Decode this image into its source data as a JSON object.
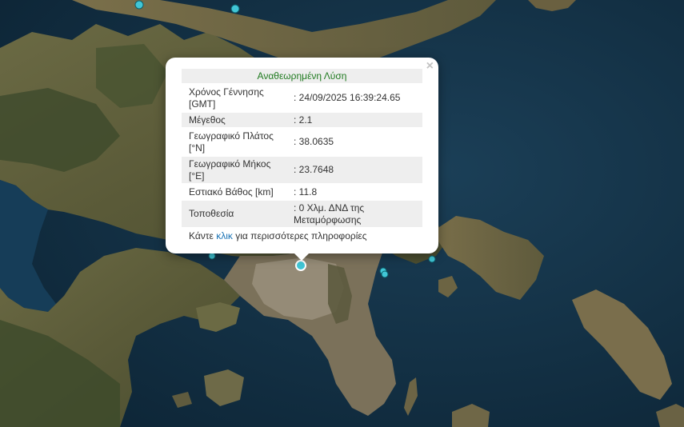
{
  "popup": {
    "title": "Αναθεωρημένη Λύση",
    "rows": [
      {
        "label": "Χρόνος Γέννησης [GMT]",
        "value": ": 24/09/2025 16:39:24.65"
      },
      {
        "label": "Μέγεθος",
        "value": ": 2.1"
      },
      {
        "label": "Γεωγραφικό Πλάτος [°N]",
        "value": ": 38.0635"
      },
      {
        "label": "Γεωγραφικό Μήκος [°E]",
        "value": ": 23.7648"
      },
      {
        "label": "Εστιακό Βάθος [km]",
        "value": ": 11.8"
      },
      {
        "label": "Τοποθεσία",
        "value": ": 0 Χλμ. ΔΝΔ της Μεταμόρφωσης"
      }
    ],
    "more_prefix": "Κάντε ",
    "more_link": "κλικ",
    "more_suffix": " για περισσότερες πληροφορίες",
    "close_glyph": "×"
  },
  "map": {
    "sea_color": "#16384f",
    "land_color": "#5a5a3a",
    "marker_color": "#41c6d6"
  }
}
